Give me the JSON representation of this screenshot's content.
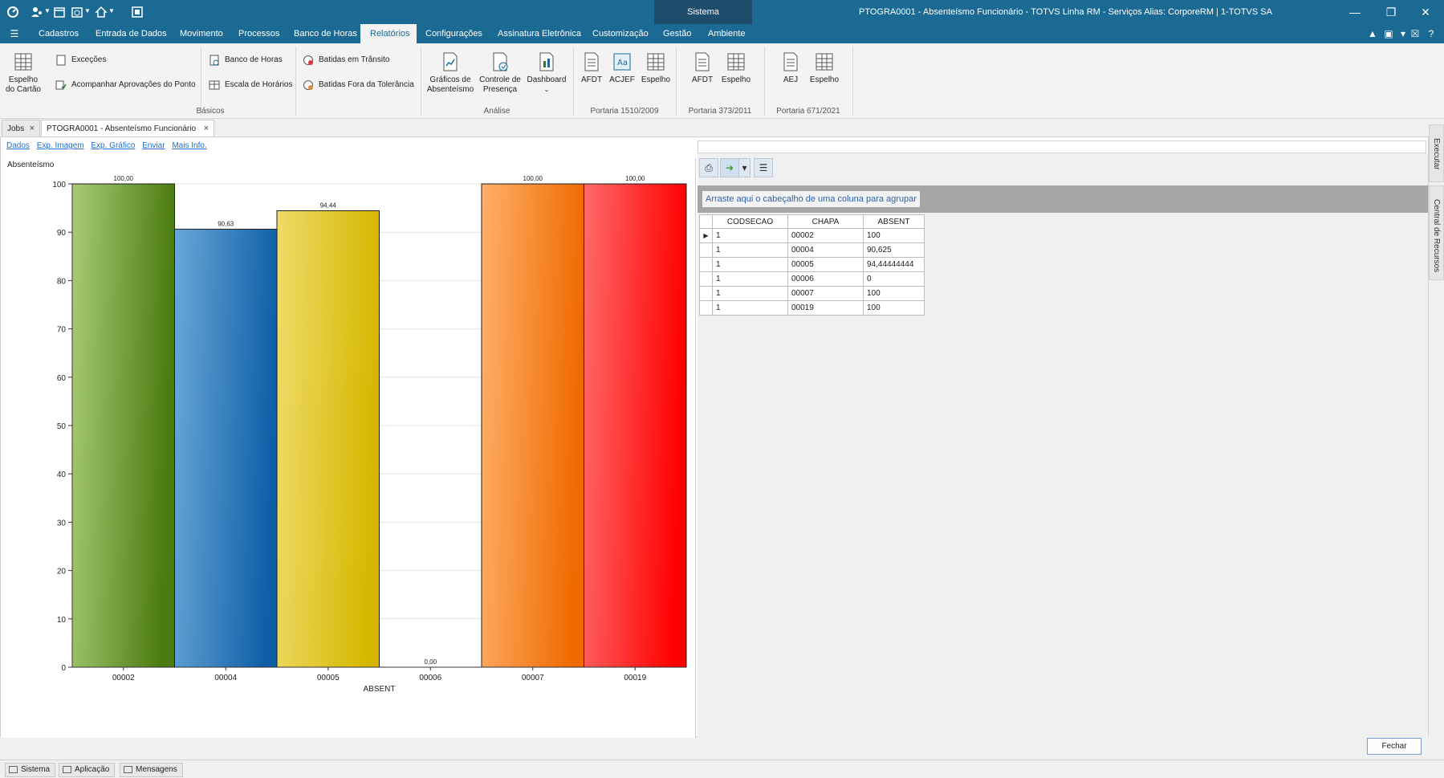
{
  "window": {
    "system_label": "Sistema",
    "title": "PTOGRA0001 - Absenteísmo Funcionário - TOTVS Linha RM - Serviços  Alias: CorporeRM | 1-TOTVS SA"
  },
  "menu": {
    "items": [
      "Cadastros",
      "Entrada de Dados",
      "Movimento",
      "Processos",
      "Banco de Horas",
      "Relatórios",
      "Configurações",
      "Assinatura Eletrônica",
      "Customização",
      "Gestão",
      "Ambiente"
    ],
    "active": "Relatórios"
  },
  "ribbon": {
    "basicos": {
      "label": "Básicos",
      "espelho_cartao": "Espelho do Cartão",
      "excecoes": "Exceções",
      "acompanhar": "Acompanhar Aprovações do Ponto",
      "banco_horas": "Banco de Horas",
      "escala_horarios": "Escala de Horários",
      "batidas_transito": "Batidas em Trânsito",
      "batidas_fora": "Batidas Fora da Tolerância"
    },
    "analise": {
      "label": "Análise",
      "graficos": "Gráficos de Absenteísmo",
      "controle": "Controle de Presença",
      "dashboard": "Dashboard"
    },
    "portaria1510": {
      "label": "Portaria 1510/2009",
      "afdt": "AFDT",
      "acjef": "ACJEF",
      "espelho": "Espelho"
    },
    "portaria373": {
      "label": "Portaria 373/2011",
      "afdt": "AFDT",
      "espelho": "Espelho"
    },
    "portaria671": {
      "label": "Portaria 671/2021",
      "aej": "AEJ",
      "espelho": "Espelho"
    }
  },
  "doctabs": {
    "jobs": "Jobs",
    "report": "PTOGRA0001 - Absenteísmo Funcionário"
  },
  "links": [
    "Dados",
    "Exp. Imagem",
    "Exp. Gráfico",
    "Enviar",
    "Mais Info."
  ],
  "grid": {
    "group_hint": "Arraste aqui o cabeçalho de uma coluna para agrupar",
    "columns": [
      "CODSECAO",
      "CHAPA",
      "ABSENT"
    ],
    "rows": [
      [
        "1",
        "00002",
        "100"
      ],
      [
        "1",
        "00004",
        "90,625"
      ],
      [
        "1",
        "00005",
        "94,44444444"
      ],
      [
        "1",
        "00006",
        "0"
      ],
      [
        "1",
        "00007",
        "100"
      ],
      [
        "1",
        "00019",
        "100"
      ]
    ]
  },
  "side_tabs": [
    "Executar",
    "Central de Recursos"
  ],
  "buttons": {
    "fechar": "Fechar"
  },
  "statusbar": [
    "Sistema",
    "Aplicação",
    "Mensagens"
  ],
  "chart_data": {
    "type": "bar",
    "title": "Absenteísmo",
    "xlabel": "ABSENT",
    "ylabel": "",
    "ylim": [
      0,
      100
    ],
    "yticks": [
      0,
      10,
      20,
      30,
      40,
      50,
      60,
      70,
      80,
      90,
      100
    ],
    "categories": [
      "00002",
      "00004",
      "00005",
      "00006",
      "00007",
      "00019"
    ],
    "values": [
      100,
      90.63,
      94.44,
      0,
      100,
      100
    ],
    "value_labels": [
      "100,00",
      "90,63",
      "94,44",
      "0,00",
      "100,00",
      "100,00"
    ],
    "bar_colors": [
      [
        "#a8cc76",
        "#4b7a10"
      ],
      [
        "#6aa8d8",
        "#0f5fa8"
      ],
      [
        "#efdc6a",
        "#d6b700"
      ],
      [
        "#ffffff",
        "#ffffff"
      ],
      [
        "#ffb06a",
        "#f06a00"
      ],
      [
        "#ff6a6a",
        "#ff0000"
      ]
    ],
    "grid": true,
    "legend": "none"
  }
}
